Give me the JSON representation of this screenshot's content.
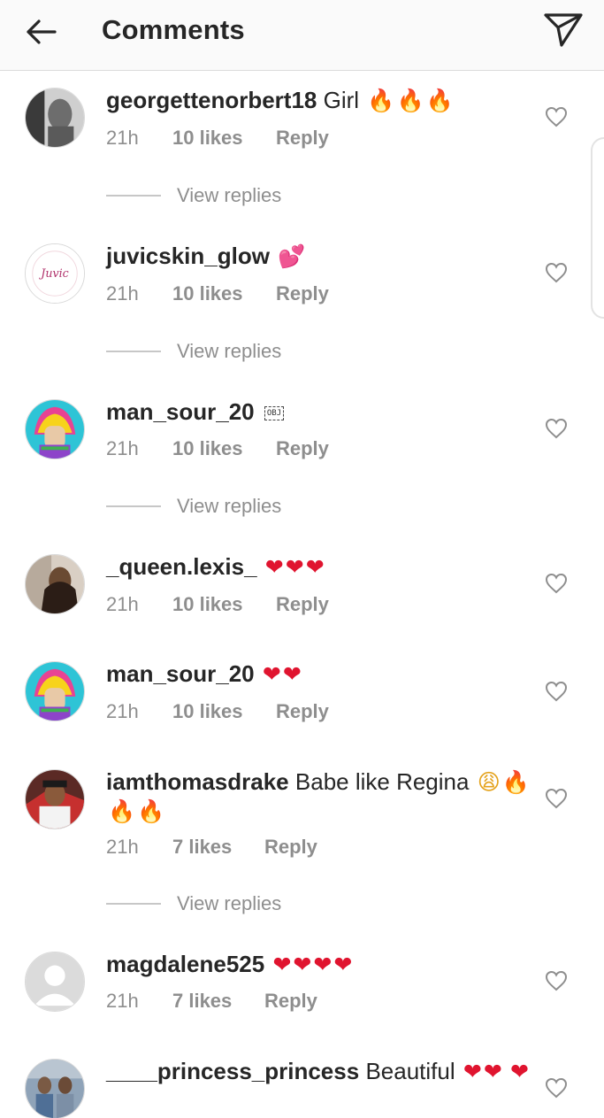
{
  "header": {
    "title": "Comments",
    "back_icon": "arrow-left-icon",
    "send_icon": "paper-plane-icon"
  },
  "view_replies_label": "View replies",
  "comments": [
    {
      "username": "georgettenorbert18",
      "text": "Girl",
      "emojis": [
        "🔥",
        "🔥",
        "🔥"
      ],
      "time": "21h",
      "likes": "10 likes",
      "reply": "Reply"
    },
    {
      "username": "juvicskin_glow",
      "text": "",
      "emojis": [
        "💕"
      ],
      "time": "21h",
      "likes": "10 likes",
      "reply": "Reply",
      "avatar_text": "Juvic"
    },
    {
      "username": "man_sour_20",
      "text": "",
      "obj": "OBJ",
      "time": "21h",
      "likes": "10 likes",
      "reply": "Reply"
    },
    {
      "username": "_queen.lexis_",
      "text": "",
      "emojis": [
        "❤",
        "❤",
        "❤"
      ],
      "time": "21h",
      "likes": "10 likes",
      "reply": "Reply"
    },
    {
      "username": "man_sour_20",
      "text": "",
      "emojis": [
        "❤",
        "❤"
      ],
      "time": "21h",
      "likes": "10 likes",
      "reply": "Reply"
    },
    {
      "username": "iamthomasdrake",
      "text": "Babe like Regina",
      "emojis": [
        "😩",
        "🔥",
        "🔥",
        "🔥"
      ],
      "time": "21h",
      "likes": "7 likes",
      "reply": "Reply"
    },
    {
      "username": "magdalene525",
      "text": "",
      "emojis": [
        "❤",
        "❤",
        "❤",
        "❤"
      ],
      "time": "21h",
      "likes": "7 likes",
      "reply": "Reply"
    },
    {
      "username": "____princess_princess",
      "text": "Beautiful",
      "emojis": [
        "❤",
        "❤",
        "❤"
      ]
    }
  ],
  "colors": {
    "text": "#262626",
    "muted": "#8e8e8e",
    "heart_emoji": "#e0142f",
    "fire_emoji": "#f7930e",
    "header_bg": "#fafafa"
  }
}
